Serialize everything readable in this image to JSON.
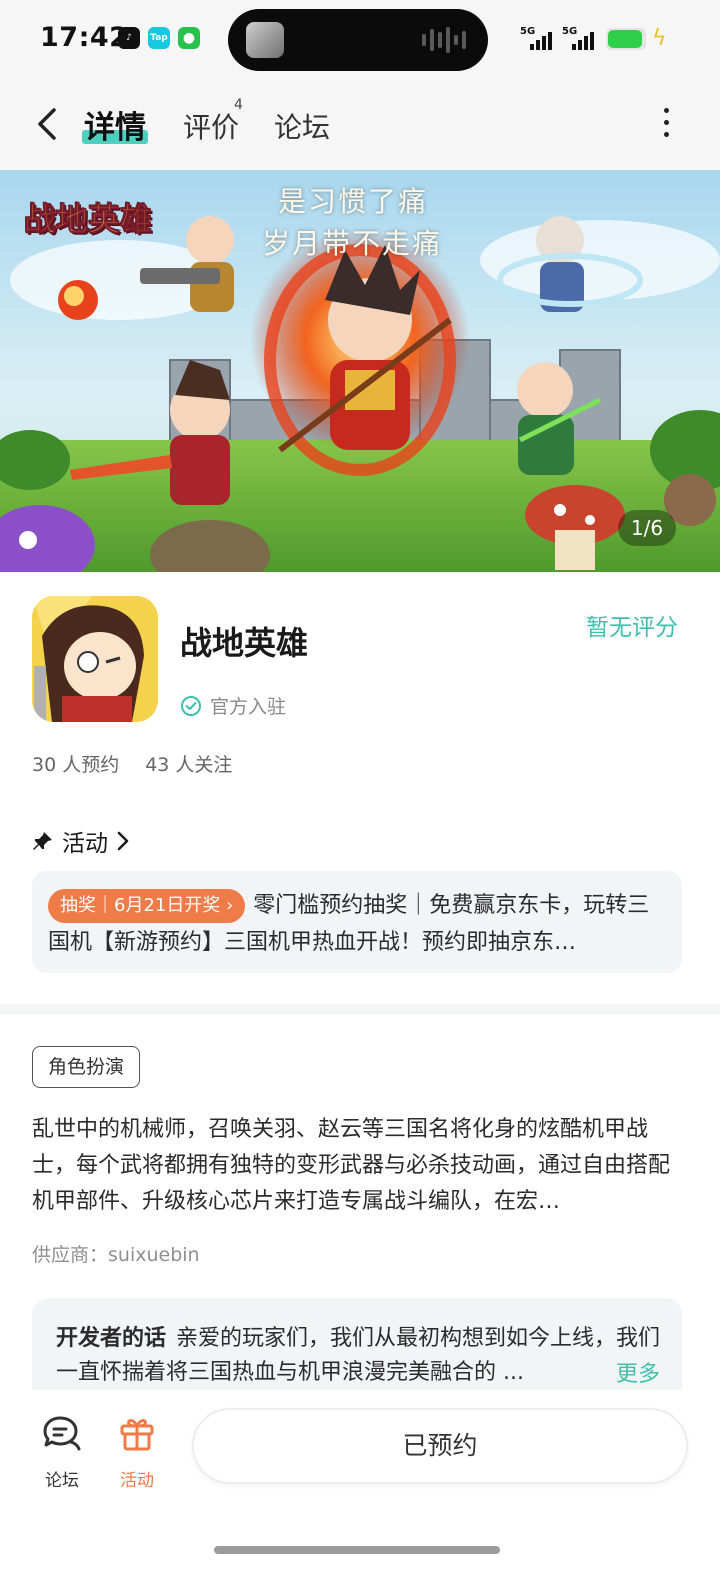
{
  "status_bar": {
    "time": "17:42",
    "notification_icons": [
      "tiktok-icon",
      "taptap-icon",
      "wechat-icon"
    ],
    "taptap_label": "Tap",
    "signal_labels": [
      "5G",
      "5G"
    ],
    "battery_color": "#2fcf4a"
  },
  "header": {
    "tabs": [
      {
        "label": "详情",
        "active": true
      },
      {
        "label": "评价",
        "badge": "4"
      },
      {
        "label": "论坛"
      }
    ],
    "accent": "#4dd0bf"
  },
  "banner": {
    "logo_text": "战地英雄",
    "lyric_line1": "是习惯了痛",
    "lyric_line2": "岁月带不走痛",
    "page_indicator": "1/6"
  },
  "app": {
    "name": "战地英雄",
    "official_label": "官方入驻",
    "rating_text": "暂无评分",
    "reservations": "30 人预约",
    "followers": "43 人关注"
  },
  "activity": {
    "section_label": "活动",
    "tag": "抽奖｜6月21日开奖 ›",
    "text": "零门槛预约抽奖｜免费赢京东卡，玩转三国机【新游预约】三国机甲热血开战！预约即抽京东…"
  },
  "details": {
    "genre_tag": "角色扮演",
    "description": "乱世中的机械师，召唤关羽、赵云等三国名将化身的炫酷机甲战士，每个武将都拥有独特的变形武器与必杀技动画，通过自由搭配机甲部件、升级核心芯片来打造专属战斗编队，在宏…",
    "supplier": "供应商：suixuebin"
  },
  "developer_note": {
    "title": "开发者的话",
    "text": "亲爱的玩家们，我们从最初构想到如今上线，我们一直怀揣着将三国热血与机甲浪漫完美融合的 ...",
    "more_label": "更多"
  },
  "bottom_bar": {
    "forum_label": "论坛",
    "activity_label": "活动",
    "reserve_button": "已预约",
    "activity_color": "#ee7b48"
  }
}
